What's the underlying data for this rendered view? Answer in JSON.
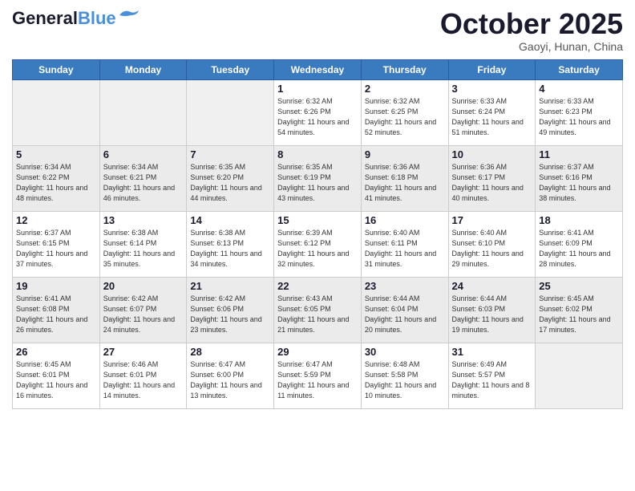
{
  "header": {
    "logo_line1": "General",
    "logo_line2": "Blue",
    "month": "October 2025",
    "location": "Gaoyi, Hunan, China"
  },
  "weekdays": [
    "Sunday",
    "Monday",
    "Tuesday",
    "Wednesday",
    "Thursday",
    "Friday",
    "Saturday"
  ],
  "weeks": [
    [
      {
        "day": "",
        "empty": true
      },
      {
        "day": "",
        "empty": true
      },
      {
        "day": "",
        "empty": true
      },
      {
        "day": "1",
        "sunrise": "6:32 AM",
        "sunset": "6:26 PM",
        "daylight": "11 hours and 54 minutes."
      },
      {
        "day": "2",
        "sunrise": "6:32 AM",
        "sunset": "6:25 PM",
        "daylight": "11 hours and 52 minutes."
      },
      {
        "day": "3",
        "sunrise": "6:33 AM",
        "sunset": "6:24 PM",
        "daylight": "11 hours and 51 minutes."
      },
      {
        "day": "4",
        "sunrise": "6:33 AM",
        "sunset": "6:23 PM",
        "daylight": "11 hours and 49 minutes."
      }
    ],
    [
      {
        "day": "5",
        "sunrise": "6:34 AM",
        "sunset": "6:22 PM",
        "daylight": "11 hours and 48 minutes."
      },
      {
        "day": "6",
        "sunrise": "6:34 AM",
        "sunset": "6:21 PM",
        "daylight": "11 hours and 46 minutes."
      },
      {
        "day": "7",
        "sunrise": "6:35 AM",
        "sunset": "6:20 PM",
        "daylight": "11 hours and 44 minutes."
      },
      {
        "day": "8",
        "sunrise": "6:35 AM",
        "sunset": "6:19 PM",
        "daylight": "11 hours and 43 minutes."
      },
      {
        "day": "9",
        "sunrise": "6:36 AM",
        "sunset": "6:18 PM",
        "daylight": "11 hours and 41 minutes."
      },
      {
        "day": "10",
        "sunrise": "6:36 AM",
        "sunset": "6:17 PM",
        "daylight": "11 hours and 40 minutes."
      },
      {
        "day": "11",
        "sunrise": "6:37 AM",
        "sunset": "6:16 PM",
        "daylight": "11 hours and 38 minutes."
      }
    ],
    [
      {
        "day": "12",
        "sunrise": "6:37 AM",
        "sunset": "6:15 PM",
        "daylight": "11 hours and 37 minutes."
      },
      {
        "day": "13",
        "sunrise": "6:38 AM",
        "sunset": "6:14 PM",
        "daylight": "11 hours and 35 minutes."
      },
      {
        "day": "14",
        "sunrise": "6:38 AM",
        "sunset": "6:13 PM",
        "daylight": "11 hours and 34 minutes."
      },
      {
        "day": "15",
        "sunrise": "6:39 AM",
        "sunset": "6:12 PM",
        "daylight": "11 hours and 32 minutes."
      },
      {
        "day": "16",
        "sunrise": "6:40 AM",
        "sunset": "6:11 PM",
        "daylight": "11 hours and 31 minutes."
      },
      {
        "day": "17",
        "sunrise": "6:40 AM",
        "sunset": "6:10 PM",
        "daylight": "11 hours and 29 minutes."
      },
      {
        "day": "18",
        "sunrise": "6:41 AM",
        "sunset": "6:09 PM",
        "daylight": "11 hours and 28 minutes."
      }
    ],
    [
      {
        "day": "19",
        "sunrise": "6:41 AM",
        "sunset": "6:08 PM",
        "daylight": "11 hours and 26 minutes."
      },
      {
        "day": "20",
        "sunrise": "6:42 AM",
        "sunset": "6:07 PM",
        "daylight": "11 hours and 24 minutes."
      },
      {
        "day": "21",
        "sunrise": "6:42 AM",
        "sunset": "6:06 PM",
        "daylight": "11 hours and 23 minutes."
      },
      {
        "day": "22",
        "sunrise": "6:43 AM",
        "sunset": "6:05 PM",
        "daylight": "11 hours and 21 minutes."
      },
      {
        "day": "23",
        "sunrise": "6:44 AM",
        "sunset": "6:04 PM",
        "daylight": "11 hours and 20 minutes."
      },
      {
        "day": "24",
        "sunrise": "6:44 AM",
        "sunset": "6:03 PM",
        "daylight": "11 hours and 19 minutes."
      },
      {
        "day": "25",
        "sunrise": "6:45 AM",
        "sunset": "6:02 PM",
        "daylight": "11 hours and 17 minutes."
      }
    ],
    [
      {
        "day": "26",
        "sunrise": "6:45 AM",
        "sunset": "6:01 PM",
        "daylight": "11 hours and 16 minutes."
      },
      {
        "day": "27",
        "sunrise": "6:46 AM",
        "sunset": "6:01 PM",
        "daylight": "11 hours and 14 minutes."
      },
      {
        "day": "28",
        "sunrise": "6:47 AM",
        "sunset": "6:00 PM",
        "daylight": "11 hours and 13 minutes."
      },
      {
        "day": "29",
        "sunrise": "6:47 AM",
        "sunset": "5:59 PM",
        "daylight": "11 hours and 11 minutes."
      },
      {
        "day": "30",
        "sunrise": "6:48 AM",
        "sunset": "5:58 PM",
        "daylight": "11 hours and 10 minutes."
      },
      {
        "day": "31",
        "sunrise": "6:49 AM",
        "sunset": "5:57 PM",
        "daylight": "11 hours and 8 minutes."
      },
      {
        "day": "",
        "empty": true
      }
    ]
  ],
  "labels": {
    "sunrise": "Sunrise:",
    "sunset": "Sunset:",
    "daylight": "Daylight:"
  }
}
